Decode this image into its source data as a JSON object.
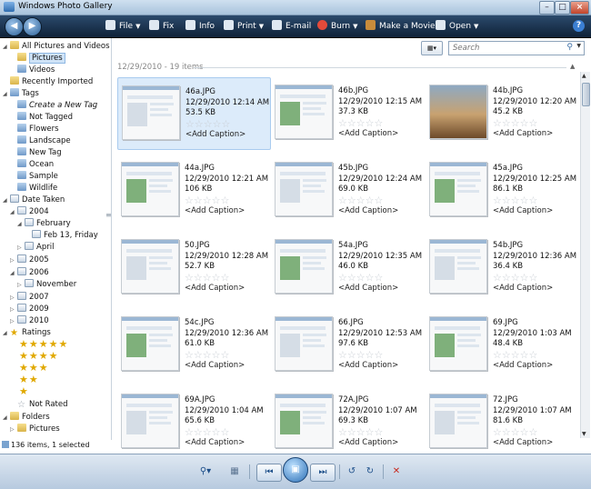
{
  "window": {
    "title": "Windows Photo Gallery",
    "buttons": [
      "–",
      "□",
      "×"
    ]
  },
  "toolbar": {
    "file": "File",
    "fix": "Fix",
    "info": "Info",
    "print": "Print",
    "email": "E-mail",
    "burn": "Burn",
    "movie": "Make a Movie",
    "open": "Open",
    "help": "?"
  },
  "nav": {
    "all_pictures": "All Pictures and Videos",
    "pictures": "Pictures",
    "videos": "Videos",
    "recently_imported": "Recently Imported",
    "tags": "Tags",
    "tag_items": [
      "Create a New Tag",
      "Not Tagged",
      "Flowers",
      "Landscape",
      "New Tag",
      "Ocean",
      "Sample",
      "Wildlife"
    ],
    "date_taken": "Date Taken",
    "y2004": "2004",
    "february": "February",
    "feb13": "Feb 13, Friday",
    "april": "April",
    "y2005": "2005",
    "y2006": "2006",
    "november": "November",
    "y2007": "2007",
    "y2009": "2009",
    "y2010": "2010",
    "ratings": "Ratings",
    "not_rated": "Not Rated",
    "folders": "Folders",
    "folder_pictures": "Pictures"
  },
  "search": {
    "placeholder": "Search"
  },
  "group": {
    "header": "12/29/2010 - 19 items"
  },
  "caption_label": "<Add Caption>",
  "star_glyphs": "☆☆☆☆☆",
  "tiles": [
    {
      "name": "46a.JPG",
      "date": "12/29/2010 12:14 AM",
      "size": "53.5 KB"
    },
    {
      "name": "46b.JPG",
      "date": "12/29/2010 12:15 AM",
      "size": "37.3 KB"
    },
    {
      "name": "44b.JPG",
      "date": "12/29/2010 12:20 AM",
      "size": "45.2 KB"
    },
    {
      "name": "44a.JPG",
      "date": "12/29/2010 12:21 AM",
      "size": "106 KB"
    },
    {
      "name": "45b.JPG",
      "date": "12/29/2010 12:24 AM",
      "size": "69.0 KB"
    },
    {
      "name": "45a.JPG",
      "date": "12/29/2010 12:25 AM",
      "size": "86.1 KB"
    },
    {
      "name": "50.JPG",
      "date": "12/29/2010 12:28 AM",
      "size": "52.7 KB"
    },
    {
      "name": "54a.JPG",
      "date": "12/29/2010 12:35 AM",
      "size": "46.0 KB"
    },
    {
      "name": "54b.JPG",
      "date": "12/29/2010 12:36 AM",
      "size": "36.4 KB"
    },
    {
      "name": "54c.JPG",
      "date": "12/29/2010 12:36 AM",
      "size": "61.0 KB"
    },
    {
      "name": "66.JPG",
      "date": "12/29/2010 12:53 AM",
      "size": "97.6 KB"
    },
    {
      "name": "69.JPG",
      "date": "12/29/2010 1:03 AM",
      "size": "48.4 KB"
    },
    {
      "name": "69A.JPG",
      "date": "12/29/2010 1:04 AM",
      "size": "65.6 KB"
    },
    {
      "name": "72A.JPG",
      "date": "12/29/2010 1:07 AM",
      "size": "69.3 KB"
    },
    {
      "name": "72.JPG",
      "date": "12/29/2010 1:07 AM",
      "size": "81.6 KB"
    }
  ],
  "status": {
    "text": "136 items, 1 selected"
  }
}
